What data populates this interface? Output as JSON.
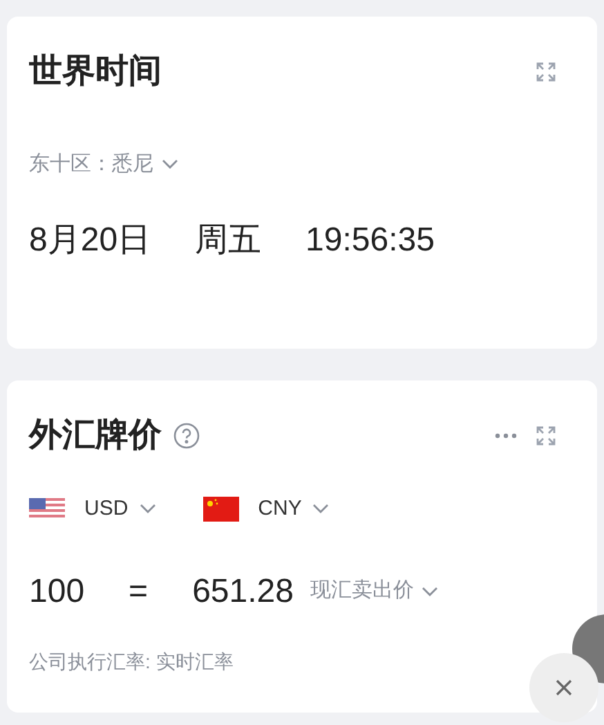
{
  "world_clock": {
    "title": "世界时间",
    "timezone": "东十区：悉尼",
    "date": "8月20日",
    "weekday": "周五",
    "time": "19:56:35"
  },
  "forex": {
    "title": "外汇牌价",
    "from_currency": "USD",
    "to_currency": "CNY",
    "amount": "100",
    "equals": "=",
    "result": "651.28",
    "rate_type": "现汇卖出价",
    "note": "公司执行汇率: 实时汇率"
  }
}
